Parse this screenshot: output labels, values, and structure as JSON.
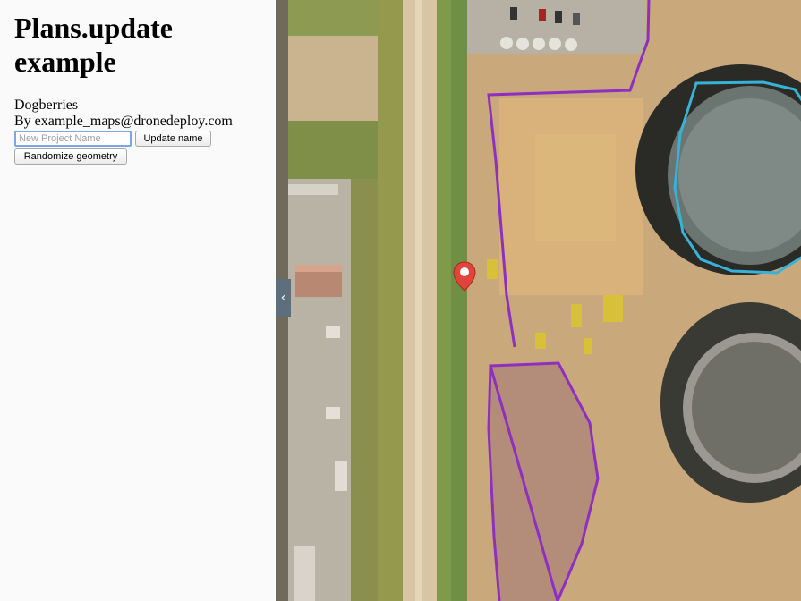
{
  "sidebar": {
    "title": "Plans.update example",
    "project_name": "Dogberries",
    "owner_line": "By example_maps@dronedeploy.com",
    "name_input": {
      "placeholder": "New Project Name",
      "value": ""
    },
    "update_button_label": "Update name",
    "randomize_button_label": "Randomize geometry"
  },
  "map": {
    "collapse_toggle_icon": "chevron-left-icon",
    "collapse_toggle_glyph": "‹",
    "marker_icon": "map-pin-icon",
    "colors": {
      "marker": "#e0443a",
      "boundary_polygon": "#8e2fc0",
      "stockpile_polygon": "#8e2fc0",
      "tank_outline": "#38b2d6"
    }
  }
}
